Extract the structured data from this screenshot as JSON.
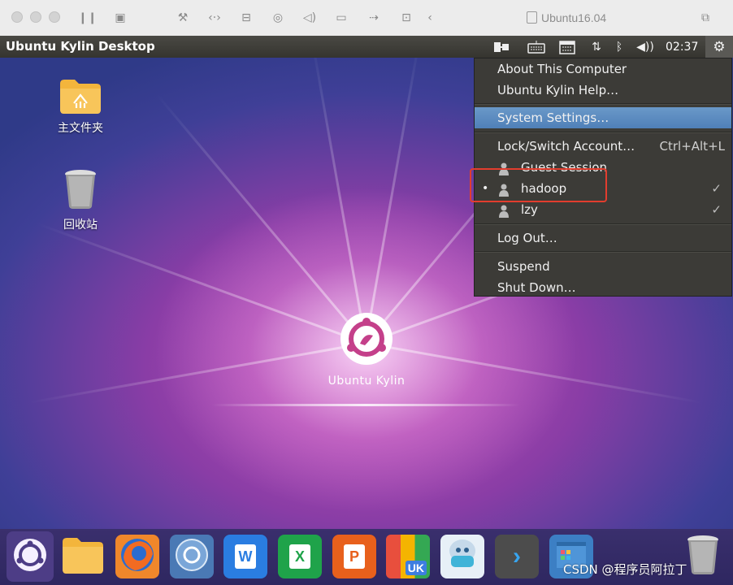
{
  "vm_window": {
    "title": "Ubuntu16.04"
  },
  "top_panel": {
    "app_title": "Ubuntu Kylin Desktop",
    "clock": "02:37",
    "indicators": [
      "sogou-input-icon",
      "keyboard-icon",
      "calendar-icon",
      "network-icon",
      "bluetooth-icon",
      "volume-icon",
      "gear-icon"
    ]
  },
  "desktop": {
    "icons": [
      {
        "label": "主文件夹",
        "icon": "home-folder-icon"
      },
      {
        "label": "回收站",
        "icon": "trash-icon"
      }
    ],
    "logo_text": "Ubuntu Kylin"
  },
  "system_menu": {
    "about": "About This Computer",
    "help": "Ubuntu Kylin Help…",
    "settings": "System Settings…",
    "lock": "Lock/Switch Account…",
    "lock_accel": "Ctrl+Alt+L",
    "guest": "Guest Session",
    "users": [
      {
        "name": "hadoop",
        "current": true,
        "checked": true
      },
      {
        "name": "lzy",
        "current": false,
        "checked": true
      }
    ],
    "logout": "Log Out…",
    "suspend": "Suspend",
    "shutdown": "Shut Down…",
    "check_mark": "✓",
    "current_dot": "•"
  },
  "dock": {
    "items": [
      {
        "name": "dash-home",
        "icon": "ubuntu-kylin-logo-icon"
      },
      {
        "name": "files",
        "icon": "folder-icon"
      },
      {
        "name": "firefox",
        "icon": "firefox-icon"
      },
      {
        "name": "browser",
        "icon": "browser-icon"
      },
      {
        "name": "wps-writer",
        "icon": "wps-writer-icon",
        "glyph": "W"
      },
      {
        "name": "wps-spreadsheet",
        "icon": "wps-spreadsheet-icon",
        "glyph": "X"
      },
      {
        "name": "wps-presentation",
        "icon": "wps-presentation-icon",
        "glyph": "P"
      },
      {
        "name": "software-center",
        "icon": "software-center-icon",
        "glyph": "UK"
      },
      {
        "name": "youker-assistant",
        "icon": "youker-assistant-icon"
      },
      {
        "name": "terminal",
        "icon": "terminal-icon",
        "glyph": "›"
      },
      {
        "name": "workspace-switcher",
        "icon": "workspace-switcher-icon"
      },
      {
        "name": "trash",
        "icon": "trash-icon"
      }
    ]
  },
  "watermark": "CSDN @程序员阿拉丁",
  "colors": {
    "panel": "#3c3b37",
    "menu_selected": "#5f8ec0",
    "highlight_box": "#e23d2e"
  }
}
